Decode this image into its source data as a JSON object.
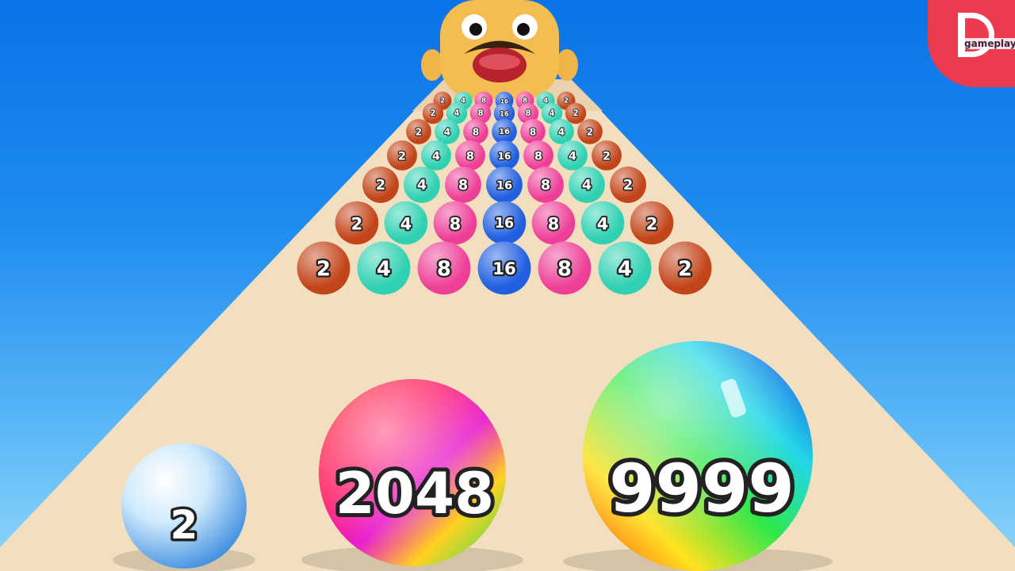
{
  "game": {
    "runner_balls": [
      {
        "label": "2",
        "tone": "light-blue"
      },
      {
        "label": "2048",
        "tone": "rainbow-red"
      },
      {
        "label": "9999",
        "tone": "rainbow-green"
      }
    ],
    "track_rows": [
      [
        "2",
        "4",
        "8",
        "16",
        "8",
        "4",
        "2"
      ],
      [
        "2",
        "4",
        "8",
        "16",
        "8",
        "4",
        "2"
      ],
      [
        "2",
        "4",
        "8",
        "16",
        "8",
        "4",
        "2"
      ],
      [
        "2",
        "4",
        "8",
        "16",
        "8",
        "4",
        "2"
      ],
      [
        "2",
        "4",
        "8",
        "16",
        "8",
        "4",
        "2"
      ],
      [
        "2",
        "4",
        "8",
        "16",
        "8",
        "4",
        "2"
      ],
      [
        "2",
        "4",
        "8",
        "16",
        "8",
        "4",
        "2"
      ]
    ],
    "ball_colors": {
      "2": "#c24419",
      "4": "#2fd1b2",
      "8": "#ee3f97",
      "16": "#1f5fe0"
    },
    "boss": "mustache-head"
  },
  "logo": {
    "text": "gameplay",
    "color": "#ec3a4f"
  }
}
